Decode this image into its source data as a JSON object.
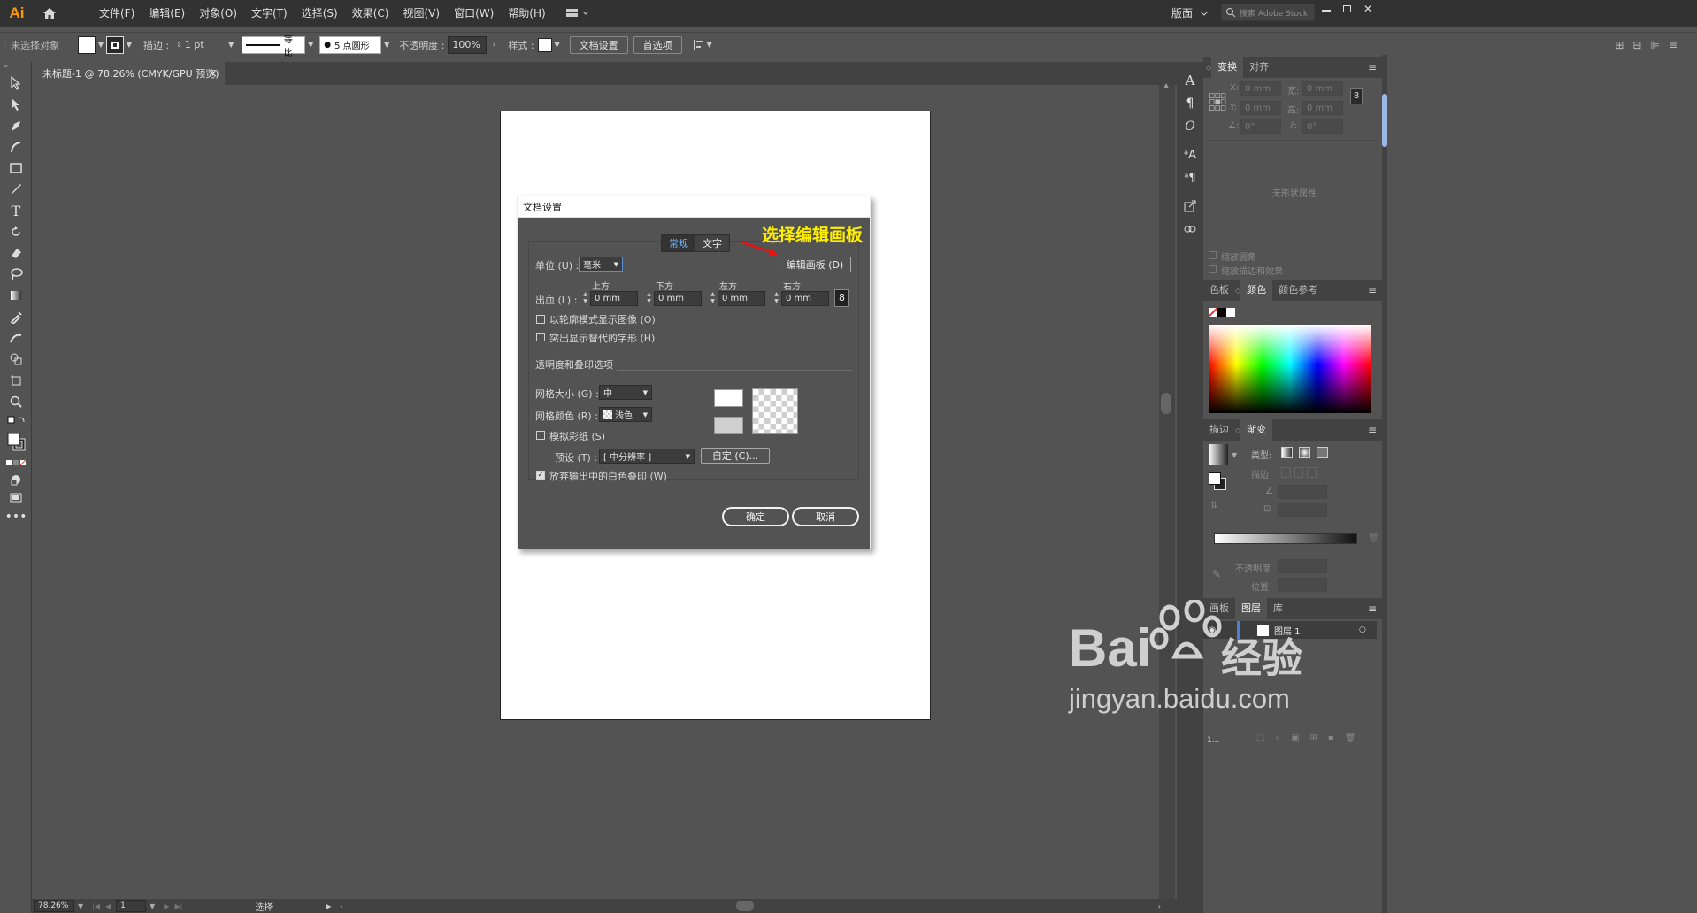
{
  "app": {
    "logo": "Ai"
  },
  "menu": [
    "文件(F)",
    "编辑(E)",
    "对象(O)",
    "文字(T)",
    "选择(S)",
    "效果(C)",
    "视图(V)",
    "窗口(W)",
    "帮助(H)"
  ],
  "topright": {
    "workspace": "版面",
    "search_placeholder": "搜索 Adobe Stock"
  },
  "control": {
    "no_selection": "未选择对象",
    "stroke_label": "描边 :",
    "stroke_value": "1 pt",
    "profile": "等比",
    "brush": "5 点圆形",
    "opacity_label": "不透明度 :",
    "opacity_value": "100%",
    "style_label": "样式 :",
    "doc_setup": "文档设置",
    "prefs": "首选项"
  },
  "document": {
    "tab_title": "未标题-1 @ 78.26% (CMYK/GPU 预览)",
    "close": "×"
  },
  "status": {
    "zoom": "78.26%",
    "page": "1",
    "tool": "选择"
  },
  "dialog": {
    "title": "文档设置",
    "tabs": [
      "常规",
      "文字"
    ],
    "annotation": "选择编辑画板",
    "unit_label": "单位 (U) :",
    "unit_value": "毫米",
    "edit_artboards": "编辑画板 (D)",
    "bleed_label": "出血 (L) :",
    "bleed_headers": [
      "上方",
      "下方",
      "左方",
      "右方"
    ],
    "bleed_values": [
      "0 mm",
      "0 mm",
      "0 mm",
      "0 mm"
    ],
    "cb_outline": "以轮廓模式显示图像 (O)",
    "cb_glyphs": "突出显示替代的字形 (H)",
    "transparency_section": "透明度和叠印选项",
    "grid_size_label": "网格大小 (G) :",
    "grid_size_value": "中",
    "grid_color_label": "网格颜色 (R) :",
    "grid_color_value": "浅色",
    "cb_paper": "模拟彩纸 (S)",
    "preset_label": "预设 (T) :",
    "preset_value": "[ 中分辨率 ]",
    "custom": "自定 (C)...",
    "cb_discard": "放弃输出中的白色叠印 (W)",
    "ok": "确定",
    "cancel": "取消"
  },
  "panels": {
    "transform_tabs": [
      "变换",
      "对齐"
    ],
    "x_label": "X:",
    "y_label": "Y:",
    "w_label": "宽:",
    "h_label": "高:",
    "x_value": "0 mm",
    "y_value": "0 mm",
    "w_value": "0 mm",
    "h_value": "0 mm",
    "angle1": "0°",
    "angle2": "0°",
    "no_shape": "无形状属性",
    "scale_corners": "缩放圆角",
    "scale_strokes": "缩放描边和效果",
    "color_tabs": [
      "色板",
      "颜色",
      "颜色参考"
    ],
    "gradient_tabs": [
      "描边",
      "渐变"
    ],
    "type_label": "类型:",
    "stroke_label": "描边",
    "opacity_label": "不透明度",
    "position_label": "位置",
    "layer_tabs": [
      "画板",
      "图层",
      "库"
    ],
    "layer_name": "图层 1",
    "layer_count": "1..."
  },
  "watermark": {
    "brand": "Bai",
    "brand2": "经验",
    "url": "jingyan.baidu.com"
  }
}
